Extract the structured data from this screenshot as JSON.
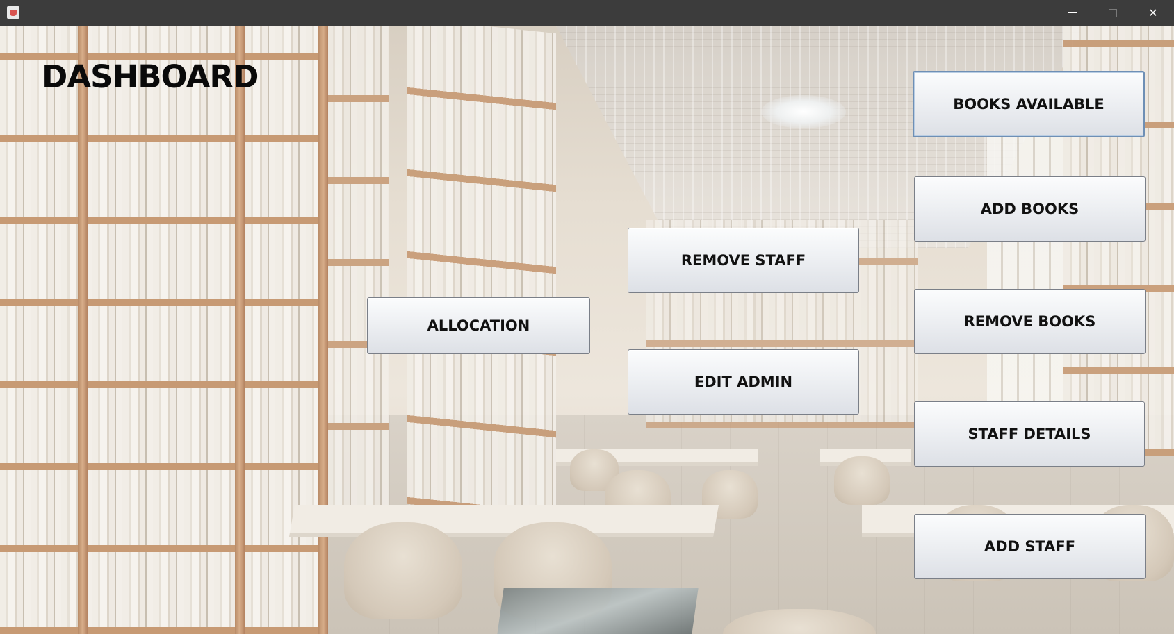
{
  "window": {
    "minimize_label": "",
    "maximize_label": "",
    "close_label": "✕"
  },
  "dashboard": {
    "title": "DASHBOARD"
  },
  "buttons": {
    "books_available": "BOOKS AVAILABLE",
    "add_books": "ADD BOOKS",
    "remove_staff": "REMOVE STAFF",
    "allocation": "ALLOCATION",
    "remove_books": "REMOVE BOOKS",
    "edit_admin": "EDIT ADMIN",
    "staff_details": "STAFF DETAILS",
    "add_staff": "ADD STAFF"
  },
  "colors": {
    "titlebar": "#3c3c3c",
    "button_border": "#7a7f88",
    "focus_border": "#6e8fb5",
    "title_text": "#0a0a0a"
  },
  "icons": {
    "app": "java-coffee-icon",
    "minimize": "minimize-icon",
    "maximize": "maximize-icon",
    "close": "close-icon"
  }
}
